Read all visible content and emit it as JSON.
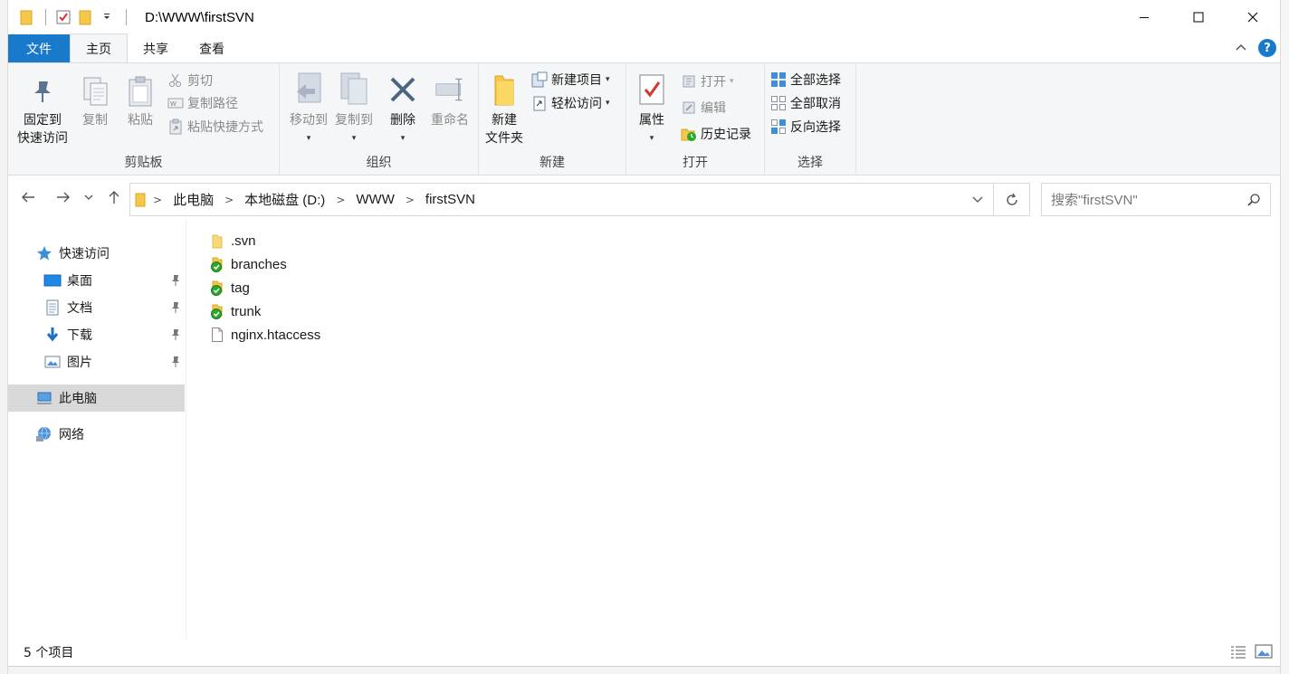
{
  "window": {
    "title": "D:\\WWW\\firstSVN"
  },
  "tabs": [
    {
      "label": "文件"
    },
    {
      "label": "主页"
    },
    {
      "label": "共享"
    },
    {
      "label": "查看"
    }
  ],
  "ribbon": {
    "clipboard": {
      "label": "剪贴板",
      "pin_line1": "固定到",
      "pin_line2": "快速访问",
      "copy": "复制",
      "paste": "粘贴",
      "cut": "剪切",
      "copy_path": "复制路径",
      "paste_shortcut": "粘贴快捷方式"
    },
    "organize": {
      "label": "组织",
      "move_to": "移动到",
      "copy_to": "复制到",
      "delete": "删除",
      "rename": "重命名"
    },
    "new": {
      "label": "新建",
      "new_folder_line1": "新建",
      "new_folder_line2": "文件夹",
      "new_item": "新建项目",
      "easy_access": "轻松访问"
    },
    "open": {
      "label": "打开",
      "properties": "属性",
      "open": "打开",
      "edit": "编辑",
      "history": "历史记录"
    },
    "select": {
      "label": "选择",
      "select_all": "全部选择",
      "select_none": "全部取消",
      "invert": "反向选择"
    }
  },
  "address": {
    "crumbs": [
      "此电脑",
      "本地磁盘 (D:)",
      "WWW",
      "firstSVN"
    ],
    "search_placeholder": "搜索\"firstSVN\""
  },
  "navpane": {
    "quick_access": "快速访问",
    "desktop": "桌面",
    "documents": "文档",
    "downloads": "下载",
    "pictures": "图片",
    "this_pc": "此电脑",
    "network": "网络"
  },
  "files": [
    {
      "name": ".svn",
      "type": "folder-plain"
    },
    {
      "name": "branches",
      "type": "folder-svn"
    },
    {
      "name": "tag",
      "type": "folder-svn"
    },
    {
      "name": "trunk",
      "type": "folder-svn"
    },
    {
      "name": "nginx.htaccess",
      "type": "file"
    }
  ],
  "status": {
    "item_count": "5 个项目"
  },
  "colors": {
    "accent": "#1979ca",
    "folder": "#f5c84c",
    "svn_ok": "#2aa82a"
  }
}
